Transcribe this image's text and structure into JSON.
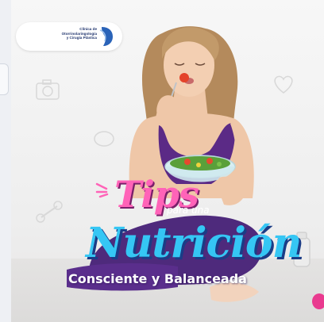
{
  "logo": {
    "line1": "Clínica de",
    "line2": "Otorrinolaringología",
    "line3": "y Cirugía Plástica"
  },
  "headline": {
    "tips": "Tips",
    "connector": "para una",
    "main": "Nutrición",
    "tagline": "Consciente y Balanceada"
  },
  "colors": {
    "tips": "#ff63b8",
    "nutricion": "#35c6f4",
    "top_purple": "#5b2a86",
    "brand_blue": "#21356e"
  },
  "icons": [
    "camera-icon",
    "heart-icon",
    "lemon-icon",
    "dumbbell-icon",
    "bottle-icon",
    "sparkle-icon"
  ]
}
